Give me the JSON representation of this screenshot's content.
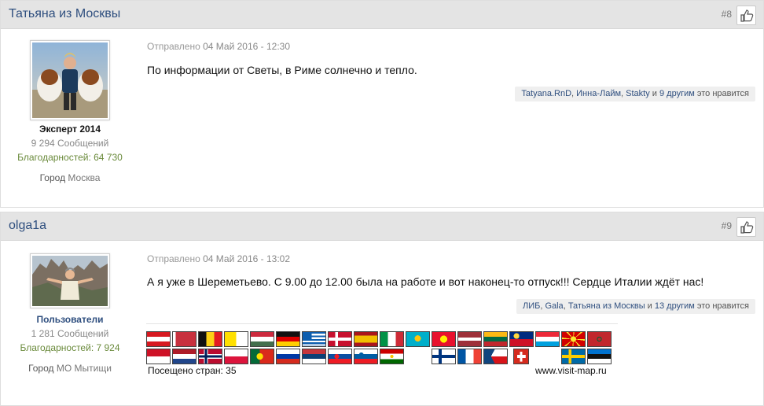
{
  "posts": [
    {
      "author": "Татьяна из Москвы",
      "number": "#8",
      "rank": "Эксперт 2014",
      "post_count": "9 294 Сообщений",
      "thanks": "Благодарностей: 64 730",
      "city_label": "Город",
      "city": "Москва",
      "date_label": "Отправлено",
      "date": "04 Май 2016 - 12:30",
      "text": "По информации от Светы, в Риме солнечно и тепло.",
      "likes": {
        "users": [
          "Tatyana.RnD",
          "Инна-Лайм",
          "Stakty"
        ],
        "sep1": ", ",
        "sep2": ", ",
        "and": " и ",
        "others": "9 другим",
        "suffix": " это нравится"
      }
    },
    {
      "author": "olga1a",
      "number": "#9",
      "rank": "Пользователи",
      "post_count": "1 281 Сообщений",
      "thanks": "Благодарностей: 7 924",
      "city_label": "Город",
      "city": "МО Мытищи",
      "date_label": "Отправлено",
      "date": "04 Май 2016 - 13:02",
      "text": "А я уже в Шереметьево. С 9.00 до 12.00 была на работе и вот наконец-то отпуск!!! Сердце Италии ждёт нас!",
      "likes": {
        "users": [
          "ЛИБ",
          "Gala",
          "Татьяна из Москвы"
        ],
        "sep1": ", ",
        "sep2": ", ",
        "and": " и ",
        "others": "13 другим",
        "suffix": " это нравится"
      }
    }
  ],
  "signature": {
    "visited": "Посещено стран: 35",
    "site": "www.visit-map.ru",
    "flags_row1": [
      "austria",
      "belarus",
      "belgium",
      "vatican",
      "hungary",
      "germany",
      "greece",
      "denmark",
      "spain",
      "italy",
      "kazakhstan",
      "kyrgyzstan",
      "latvia",
      "lithuania",
      "liechtenstein",
      "luxembourg",
      "macedonia",
      "morocco"
    ],
    "flags_row2": [
      "monaco",
      "netherlands",
      "norway",
      "poland",
      "portugal",
      "russia",
      "serbia",
      "slovakia",
      "slovenia",
      "tajikistan",
      "",
      "finland",
      "france",
      "czechia",
      "switzerland",
      "",
      "sweden",
      "estonia"
    ]
  }
}
